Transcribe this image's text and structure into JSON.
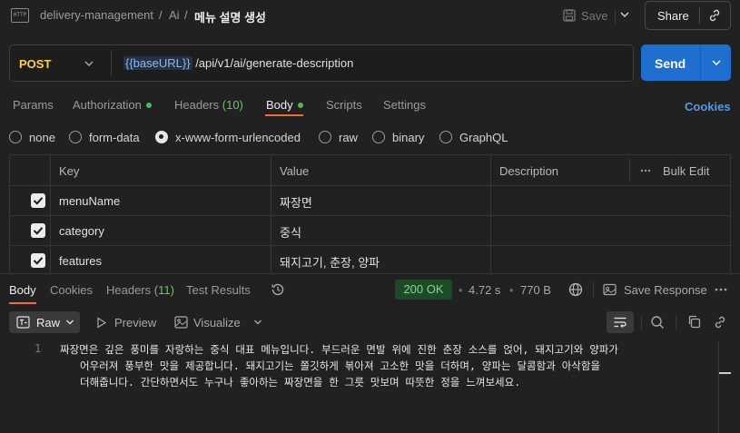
{
  "breadcrumb": {
    "collection": "delivery-management",
    "sep1": "/",
    "folder": "Ai",
    "sep2": "/",
    "request": "메뉴 설명 생성"
  },
  "header": {
    "http_badge": "HTTP",
    "save_label": "Save",
    "share_label": "Share"
  },
  "request": {
    "method": "POST",
    "url_var": "{{baseURL}}",
    "url_path": " /api/v1/ai/generate-description",
    "send_label": "Send"
  },
  "tabs": {
    "params": "Params",
    "authorization": "Authorization",
    "headers": "Headers",
    "headers_count": "(10)",
    "body": "Body",
    "scripts": "Scripts",
    "settings": "Settings",
    "cookies": "Cookies"
  },
  "body_types": [
    "none",
    "form-data",
    "x-www-form-urlencoded",
    "raw",
    "binary",
    "GraphQL"
  ],
  "body_type_selected": "x-www-form-urlencoded",
  "table": {
    "headers": {
      "key": "Key",
      "value": "Value",
      "description": "Description",
      "bulk_edit": "Bulk Edit"
    },
    "rows": [
      {
        "key": "menuName",
        "value": "짜장면",
        "checked": true
      },
      {
        "key": "category",
        "value": "중식",
        "checked": true
      },
      {
        "key": "features",
        "value": "돼지고기, 춘장, 양파",
        "checked": true
      }
    ]
  },
  "response": {
    "tabs": {
      "body": "Body",
      "cookies": "Cookies",
      "headers": "Headers",
      "headers_count": "(11)",
      "test_results": "Test Results"
    },
    "status": "200 OK",
    "time": "4.72 s",
    "size": "770 B",
    "save_response": "Save Response",
    "view": {
      "raw": "Raw",
      "preview": "Preview",
      "visualize": "Visualize"
    },
    "line_number": "1",
    "content": "짜장면은 깊은 풍미를 자랑하는 중식 대표 메뉴입니다. 부드러운 면발 위에 진한 춘장 소스를 얹어, 돼지고기와 양파가 어우러져 풍부한 맛을 제공합니다. 돼지고기는 쫄깃하게 볶아져 고소한 맛을 더하며, 양파는 달콤함과 아삭함을 더해줍니다. 간단하면서도 누구나 좋아하는 짜장면을 한 그릇 맛보며 따뜻한 정을 느껴보세요."
  },
  "colors": {
    "accent": "#f26b3a",
    "send": "#1f6fd1",
    "method": "#f5d04a",
    "status_ok": "#7fdc8a"
  }
}
